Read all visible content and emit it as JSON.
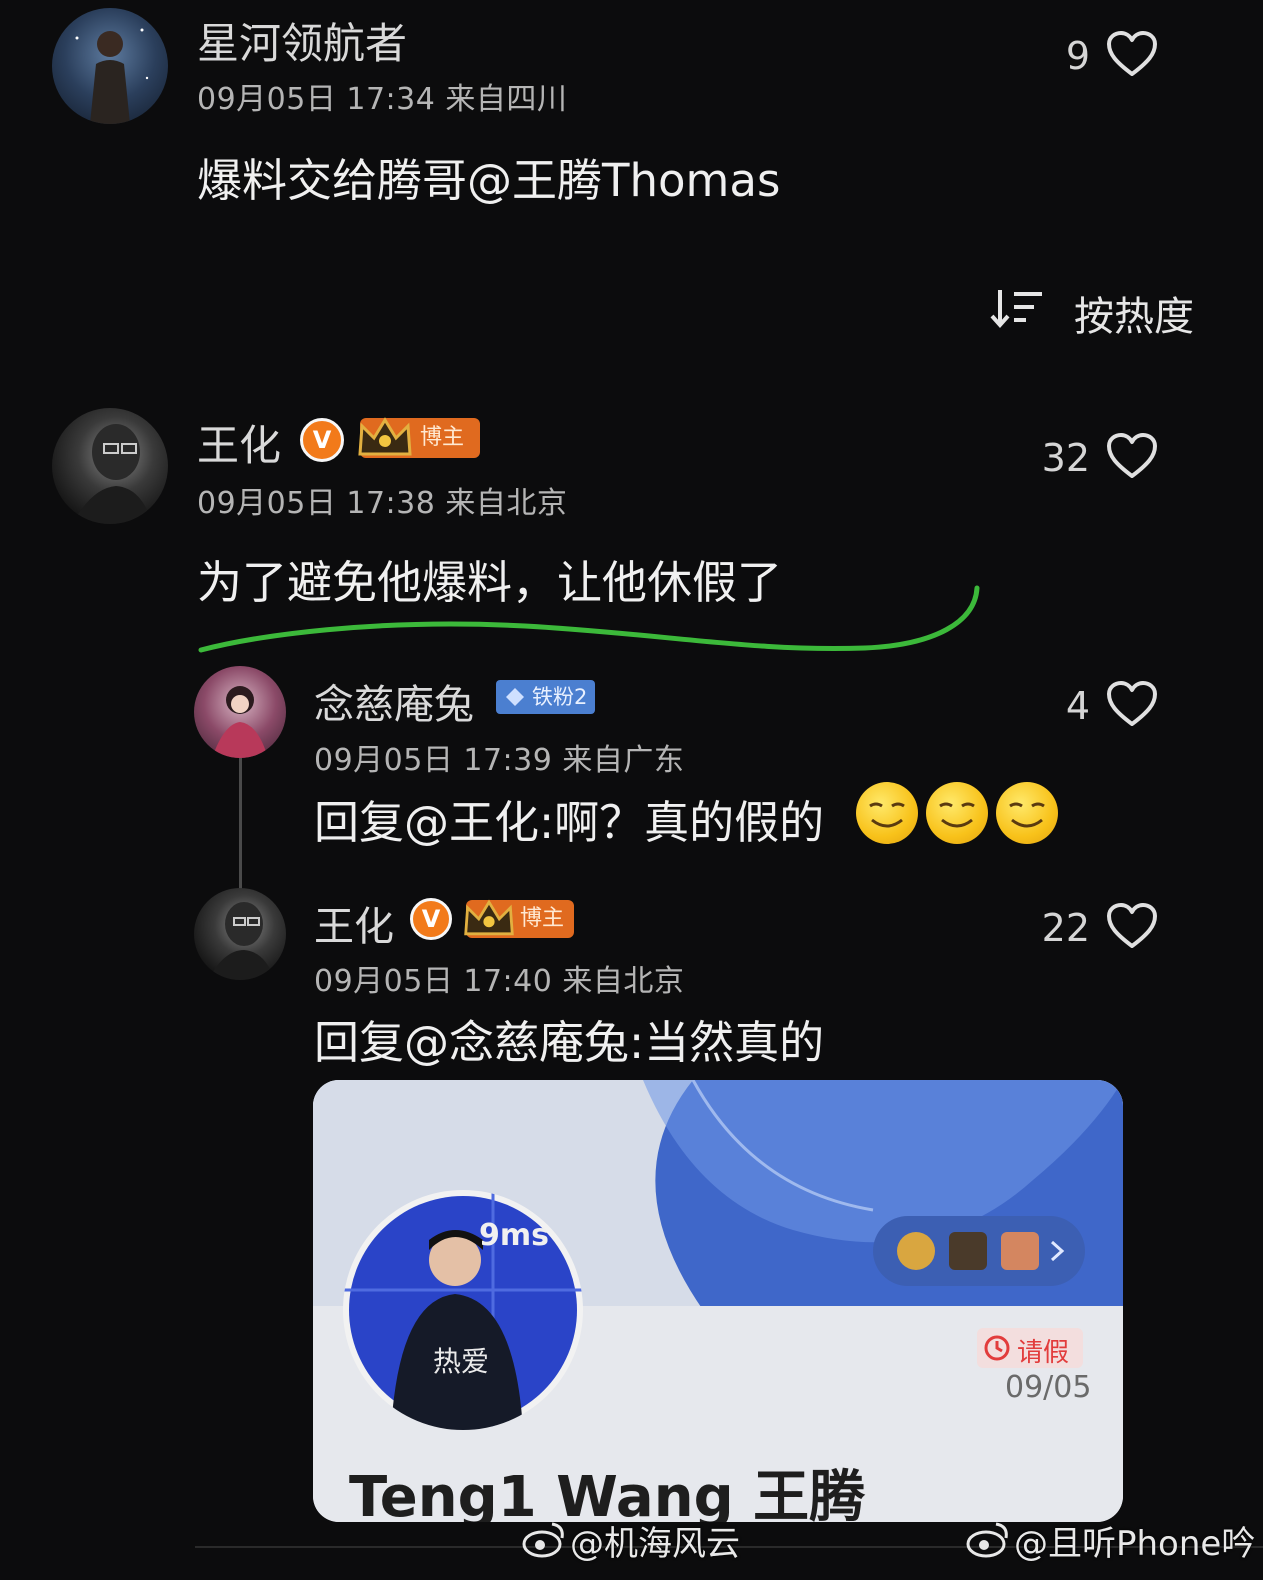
{
  "sort": {
    "label": "按热度",
    "icon": "sort-descending-icon"
  },
  "top_comment": {
    "username": "星河领航者",
    "meta": "09月05日 17:34 来自四川",
    "content": "爆料交给腾哥@王腾Thomas",
    "likes": "9"
  },
  "main_comment": {
    "username": "王化",
    "verified_badge": "V",
    "role_badge": "博主",
    "meta": "09月05日 17:38 来自北京",
    "content": "为了避免他爆料，让他休假了",
    "likes": "32"
  },
  "replies": [
    {
      "username": "念慈庵兔",
      "fan_badge": "铁粉2",
      "meta": "09月05日 17:39 来自广东",
      "content": "回复@王化:啊？真的假的",
      "likes": "4",
      "emoji": "smirk-emoji"
    },
    {
      "username": "王化",
      "verified_badge": "V",
      "role_badge": "博主",
      "meta": "09月05日 17:40 来自北京",
      "content": "回复@念慈庵兔:当然真的",
      "likes": "22"
    }
  ],
  "image_card": {
    "profile_name": "Teng1 Wang 王腾",
    "leave_status": "请假",
    "leave_date": "09/05",
    "avatar_text": "9ms",
    "shirt_text": "热爱"
  },
  "watermarks": [
    "@机海风云",
    "@且听Phone吟"
  ],
  "colors": {
    "background": "#0c0c0d",
    "verified": "#f27a1a",
    "blogger_badge": "#e06a1f",
    "fan_badge": "#4b7fd0",
    "underline": "#3cb93a"
  }
}
